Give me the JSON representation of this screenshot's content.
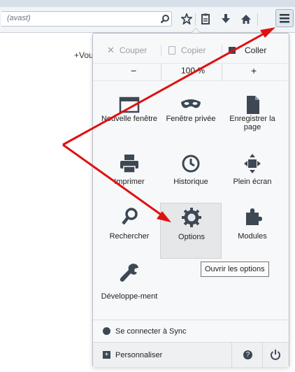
{
  "toolbar": {
    "url_text": "(avast)",
    "icons": [
      "search-icon",
      "star-icon",
      "clipboard-icon",
      "download-icon",
      "home-icon",
      "menu-icon"
    ]
  },
  "page_behind_text": "+Vou",
  "menu": {
    "edit": {
      "cut": "Couper",
      "copy": "Copier",
      "paste": "Coller"
    },
    "zoom": {
      "minus": "−",
      "value": "100 %",
      "plus": "+"
    },
    "tiles": [
      {
        "label": "Nouvelle fenêtre",
        "icon": "new-window-icon"
      },
      {
        "label": "Fenêtre privée",
        "icon": "private-mask-icon"
      },
      {
        "label": "Enregistrer la page",
        "icon": "save-page-icon"
      },
      {
        "label": "Imprimer",
        "icon": "print-icon"
      },
      {
        "label": "Historique",
        "icon": "history-icon"
      },
      {
        "label": "Plein écran",
        "icon": "fullscreen-icon"
      },
      {
        "label": "Rechercher",
        "icon": "search-icon"
      },
      {
        "label": "Options",
        "icon": "gear-icon"
      },
      {
        "label": "Modules",
        "icon": "puzzle-icon"
      },
      {
        "label": "Développe-ment",
        "icon": "wrench-icon"
      }
    ],
    "tooltip": "Ouvrir les options",
    "sync": "Se connecter à Sync",
    "customize": "Personnaliser"
  },
  "colors": {
    "annotation_arrow": "#e01010",
    "highlight": "#e6e7e9"
  }
}
